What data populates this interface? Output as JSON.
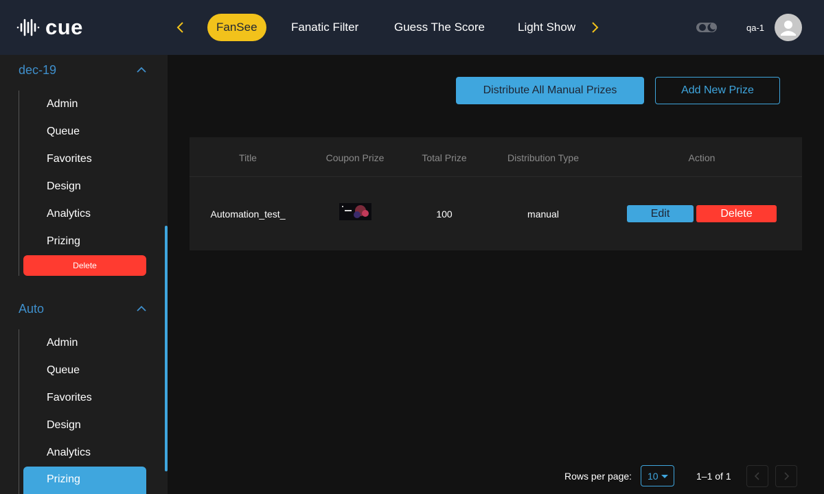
{
  "app": {
    "logo_text": "cue"
  },
  "header": {
    "tabs": [
      {
        "label": "FanSee",
        "active": true
      },
      {
        "label": "Fanatic Filter",
        "active": false
      },
      {
        "label": "Guess The Score",
        "active": false
      },
      {
        "label": "Light Show",
        "active": false
      }
    ],
    "user_name": "qa-1",
    "theme_toggle_icon": "moon-icon",
    "accent_color": "#f2c21b"
  },
  "sidebar": {
    "groups": [
      {
        "title": "dec-19",
        "expanded": true,
        "items": [
          "Admin",
          "Queue",
          "Favorites",
          "Design",
          "Analytics",
          "Prizing"
        ],
        "delete_label": "Delete"
      },
      {
        "title": "Auto",
        "expanded": true,
        "items": [
          "Admin",
          "Queue",
          "Favorites",
          "Design",
          "Analytics",
          "Prizing"
        ],
        "active_item": "Prizing"
      }
    ]
  },
  "main": {
    "distribute_button": "Distribute All Manual Prizes",
    "add_button": "Add New Prize",
    "table": {
      "columns": [
        "Title",
        "Coupon Prize",
        "Total Prize",
        "Distribution Type",
        "Action"
      ],
      "rows": [
        {
          "title": "Automation_test_",
          "total_prize": "100",
          "distribution_type": "manual",
          "edit_label": "Edit",
          "delete_label": "Delete"
        }
      ]
    },
    "pagination": {
      "rows_per_page_label": "Rows per page:",
      "rows_per_page": "10",
      "range": "1–1 of 1"
    }
  },
  "colors": {
    "primary": "#3fa6de",
    "danger": "#ff3b30",
    "topbar": "#1e2533",
    "sidebar_group_title": "#3f8fcb"
  }
}
